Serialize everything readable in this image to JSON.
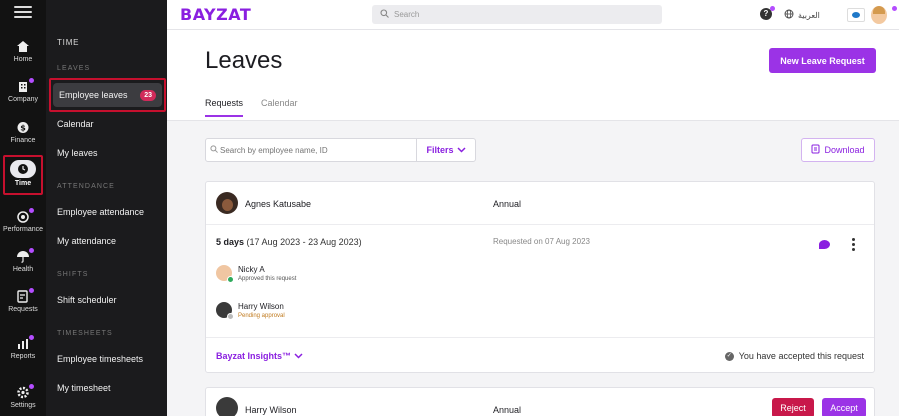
{
  "rail": {
    "items": [
      {
        "label": "Home",
        "icon": "home-icon"
      },
      {
        "label": "Company",
        "icon": "building-icon"
      },
      {
        "label": "Finance",
        "icon": "dollar-icon"
      },
      {
        "label": "Time",
        "icon": "clock-icon"
      },
      {
        "label": "Performance",
        "icon": "target-icon"
      },
      {
        "label": "Health",
        "icon": "umbrella-icon"
      },
      {
        "label": "Requests",
        "icon": "requests-icon"
      },
      {
        "label": "Reports",
        "icon": "chart-icon"
      },
      {
        "label": "Settings",
        "icon": "gear-icon"
      }
    ]
  },
  "sidebar": {
    "section": "TIME",
    "groups": {
      "leaves": "LEAVES",
      "attendance": "ATTENDANCE",
      "shifts": "SHIFTS",
      "timesheets": "TIMESHEETS"
    },
    "items": {
      "employee_leaves": "Employee leaves",
      "employee_leaves_count": "23",
      "calendar": "Calendar",
      "my_leaves": "My leaves",
      "employee_attendance": "Employee attendance",
      "my_attendance": "My attendance",
      "shift_scheduler": "Shift scheduler",
      "employee_timesheets": "Employee timesheets",
      "my_timesheet": "My timesheet"
    }
  },
  "topbar": {
    "logo": "BAYZAT",
    "search_placeholder": "Search",
    "help": "?",
    "language": "العربية"
  },
  "page": {
    "title": "Leaves",
    "new_request": "New Leave Request",
    "tabs": [
      "Requests",
      "Calendar"
    ]
  },
  "filters": {
    "search_placeholder": "Search by employee name, ID",
    "filters_label": "Filters",
    "download_label": "Download"
  },
  "requests": [
    {
      "employee": "Agnes Katusabe",
      "type": "Annual",
      "days_bold": "5 days",
      "range": "(17 Aug 2023 - 23 Aug 2023)",
      "requested": "Requested on 07 Aug 2023",
      "approvers": [
        {
          "name": "Nicky A",
          "status": "Approved this request",
          "status_color": "#555555"
        },
        {
          "name": "Harry Wilson",
          "status": "Pending approval",
          "status_color": "#c07a1e"
        }
      ],
      "insights": "Bayzat Insights™",
      "accepted_text": "You have accepted this request"
    },
    {
      "employee": "Harry Wilson",
      "type": "Annual",
      "reject": "Reject",
      "accept": "Accept"
    }
  ],
  "colors": {
    "brand": "#8a1fe0",
    "primary_button": "#9b33e6",
    "reject": "#c8184a",
    "highlight_border": "#c6102e"
  }
}
